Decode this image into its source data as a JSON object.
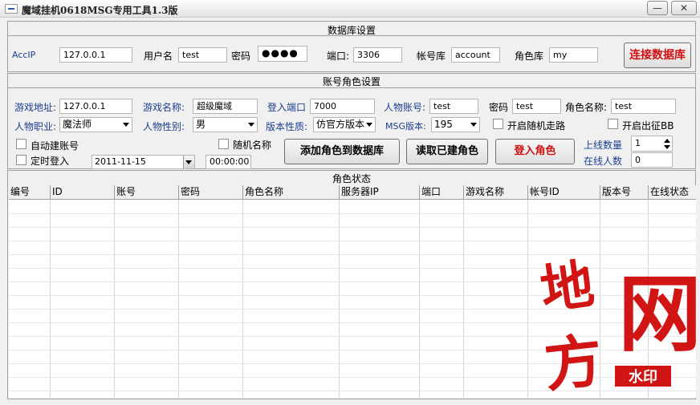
{
  "window": {
    "title": "魔域挂机0618MSG专用工具1.3版",
    "minimize": "—",
    "close": "✕"
  },
  "db_settings": {
    "title": "数据库设置",
    "acc_ip_label": "AccIP",
    "acc_ip": "127.0.0.1",
    "user_label": "用户名",
    "user": "test",
    "password_label": "密码",
    "password": "●●●●",
    "port_label": "端口:",
    "port": "3306",
    "account_db_label": "帐号库",
    "account_db": "account",
    "role_db_label": "角色库",
    "role_db": "my",
    "connect_button": "连接数据库"
  },
  "account_settings": {
    "title": "账号角色设置",
    "game_addr_label": "游戏地址:",
    "game_addr": "127.0.0.1",
    "game_name_label": "游戏名称:",
    "game_name": "超级魔域",
    "login_port_label": "登入端口",
    "login_port": "7000",
    "char_account_label": "人物账号:",
    "char_account": "test",
    "password_label": "密码",
    "password": "test",
    "role_name_label": "角色名称:",
    "role_name": "test",
    "profession_label": "人物职业:",
    "profession": "魔法师",
    "gender_label": "人物性别:",
    "gender": "男",
    "version_type_label": "版本性质:",
    "version_type": "仿官方版本",
    "msg_version_label": "MSG版本:",
    "msg_version": "195",
    "random_walk_label": "开启随机走路",
    "expedition_label": "开启出征BB",
    "auto_create_label": "自动建账号",
    "timed_login_label": "定时登入",
    "random_name_label": "随机名称",
    "date": "2011-11-15",
    "time": "00:00:00",
    "add_role_button": "添加角色到数据库",
    "read_roles_button": "读取已建角色",
    "login_role_button": "登入角色",
    "online_count_label": "上线数量",
    "online_count": "1",
    "online_people_label": "在线人数",
    "online_people": "0"
  },
  "role_status": {
    "title": "角色状态",
    "columns": [
      "编号",
      "ID",
      "账号",
      "密码",
      "角色名称",
      "服务器IP",
      "端口",
      "游戏名称",
      "帐号ID",
      "版本号",
      "在线状态"
    ]
  },
  "watermark": {
    "text1": "地方",
    "text2": "网",
    "badge": "水印",
    "color": "#d11414"
  }
}
